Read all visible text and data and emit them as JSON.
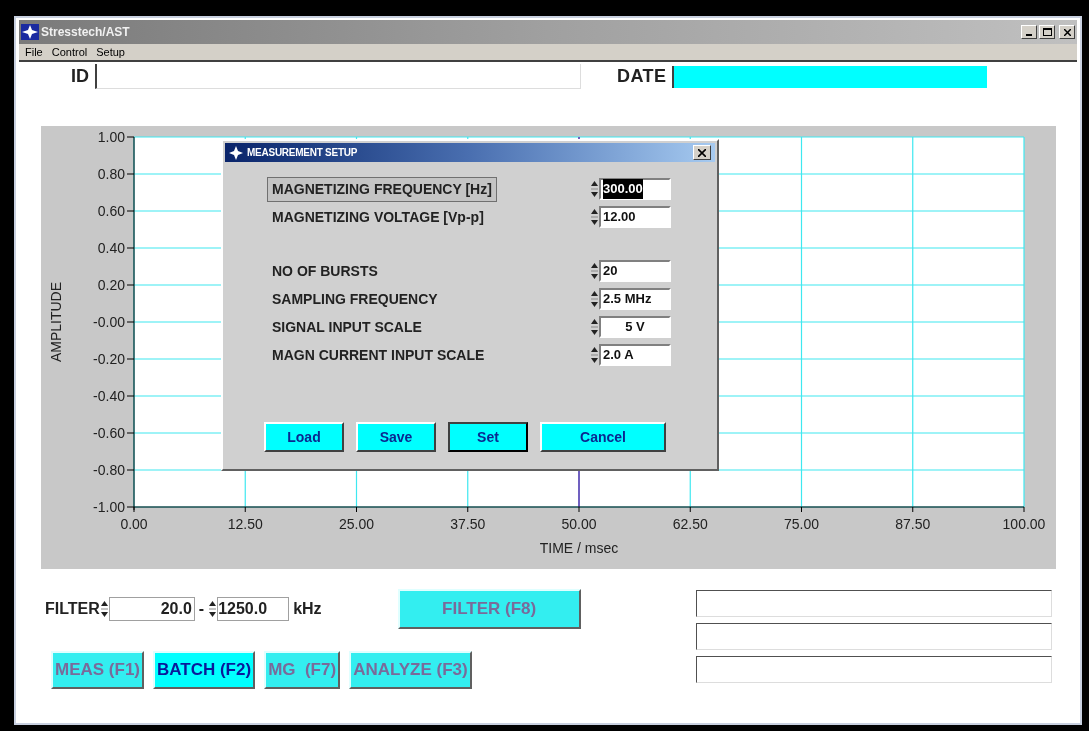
{
  "window": {
    "title": "Stresstech/AST"
  },
  "menu": [
    {
      "label": "File"
    },
    {
      "label": "Control"
    },
    {
      "label": "Setup"
    }
  ],
  "header": {
    "id": {
      "label": "ID",
      "highlighted": false
    },
    "date": {
      "label": "DATE",
      "highlighted": true
    }
  },
  "chart": {
    "chart_data": {
      "type": "line",
      "xlabel": "TIME / msec",
      "ylabel": "AMPLITUDE",
      "xlim": [
        0,
        100
      ],
      "ylim": [
        -1,
        1
      ],
      "xticks": [
        {
          "value": 0,
          "label": "0.00"
        },
        {
          "value": 12.5,
          "label": "12.50"
        },
        {
          "value": 25,
          "label": "25.00"
        },
        {
          "value": 37.5,
          "label": "37.50"
        },
        {
          "value": 50,
          "label": "50.00"
        },
        {
          "value": 62.5,
          "label": "62.50"
        },
        {
          "value": 75,
          "label": "75.00"
        },
        {
          "value": 87.5,
          "label": "87.50"
        },
        {
          "value": 100,
          "label": "100.00"
        }
      ],
      "yticks": [
        {
          "value": 1,
          "label": "1.00"
        },
        {
          "value": 0.8,
          "label": "0.80"
        },
        {
          "value": 0.6,
          "label": "0.60"
        },
        {
          "value": 0.4,
          "label": "0.40"
        },
        {
          "value": 0.2,
          "label": "0.20"
        },
        {
          "value": 0,
          "label": "-0.00"
        },
        {
          "value": -0.2,
          "label": "-0.20"
        },
        {
          "value": -0.4,
          "label": "-0.40"
        },
        {
          "value": -0.6,
          "label": "-0.60"
        },
        {
          "value": -0.8,
          "label": "-0.80"
        },
        {
          "value": -1,
          "label": "-1.00"
        }
      ],
      "grid": true,
      "ref_lines": [
        {
          "axis": "x",
          "value": 50,
          "color": "#7060c0"
        }
      ]
    }
  },
  "dialog": {
    "title": "MEASUREMENT SETUP",
    "groups": [
      {
        "fields": [
          {
            "label": "MAGNETIZING FREQUENCY [Hz]",
            "value": "300.00",
            "focused": true,
            "centered": false
          },
          {
            "label": "MAGNETIZING VOLTAGE [Vp-p]",
            "value": "12.00",
            "focused": false,
            "centered": false
          }
        ]
      },
      {
        "fields": [
          {
            "label": "NO OF BURSTS",
            "value": "20",
            "focused": false,
            "centered": false
          },
          {
            "label": "SAMPLING FREQUENCY",
            "value": "2.5 MHz",
            "focused": false,
            "centered": false
          },
          {
            "label": "SIGNAL INPUT SCALE",
            "value": "5 V",
            "focused": false,
            "centered": true
          },
          {
            "label": "MAGN CURRENT INPUT SCALE",
            "value": "2.0 A",
            "focused": false,
            "centered": false
          }
        ]
      }
    ],
    "buttons": [
      {
        "label": "Load",
        "default": false
      },
      {
        "label": "Save",
        "default": false
      },
      {
        "label": "Set",
        "default": true
      },
      {
        "label": "Cancel",
        "default": false
      }
    ]
  },
  "filter": {
    "label": "FILTER",
    "low": "20.0",
    "separator": "-",
    "high": "1250.0",
    "unit": "kHz",
    "button": "FILTER (F8)"
  },
  "buttons": [
    {
      "label": "MEAS (F1)",
      "selected": false
    },
    {
      "label": "BATCH (F2)",
      "selected": true
    },
    {
      "label": "MG  (F7)",
      "selected": false
    },
    {
      "label": "ANALYZE (F3)",
      "selected": false
    }
  ]
}
